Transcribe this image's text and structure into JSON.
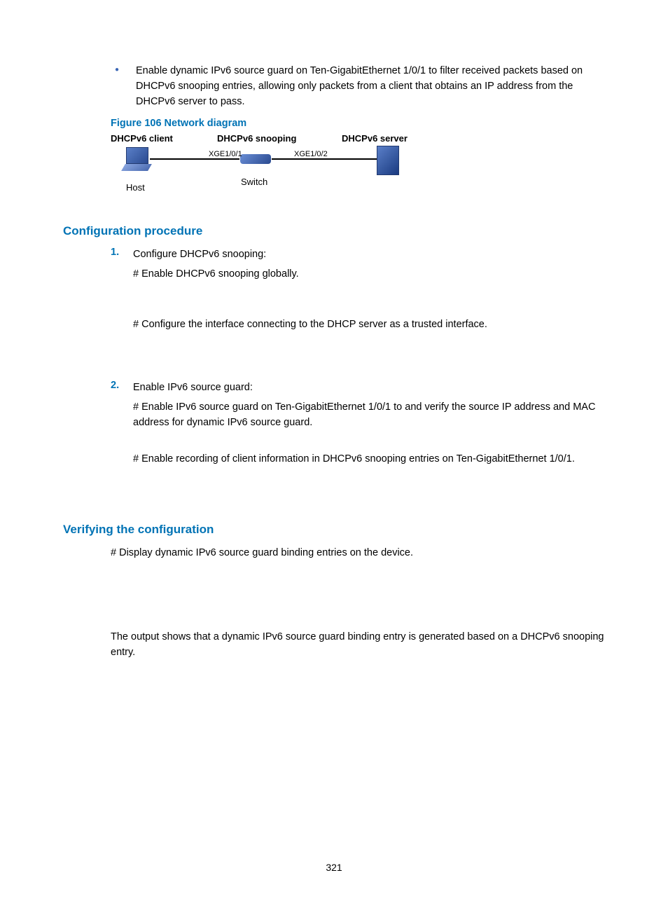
{
  "bullet": "Enable dynamic IPv6 source guard on Ten-GigabitEthernet 1/0/1 to filter received packets based on DHCPv6 snooping entries, allowing only packets from a client that obtains an IP address from the DHCPv6 server to pass.",
  "figure_caption": "Figure 106 Network diagram",
  "diagram": {
    "client": "DHCPv6 client",
    "snooping": "DHCPv6 snooping",
    "server": "DHCPv6 server",
    "if1": "XGE1/0/1",
    "if2": "XGE1/0/2",
    "host": "Host",
    "switch": "Switch"
  },
  "h_config": "Configuration procedure",
  "step1_title": "Configure DHCPv6 snooping:",
  "step1_a": "# Enable DHCPv6 snooping globally.",
  "step1_b": "# Configure the interface connecting to the DHCP server as a trusted interface.",
  "step2_title": "Enable IPv6 source guard:",
  "step2_a": "# Enable IPv6 source guard on Ten-GigabitEthernet 1/0/1 to and verify the source IP address and MAC address for dynamic IPv6 source guard.",
  "step2_b": "# Enable recording of client information in DHCPv6 snooping entries on Ten-GigabitEthernet 1/0/1.",
  "h_verify": "Verifying the configuration",
  "verify_a": "# Display dynamic IPv6 source guard binding entries on the device.",
  "verify_b": "The output shows that a dynamic IPv6 source guard binding entry is generated based on a DHCPv6 snooping entry.",
  "page_number": "321"
}
